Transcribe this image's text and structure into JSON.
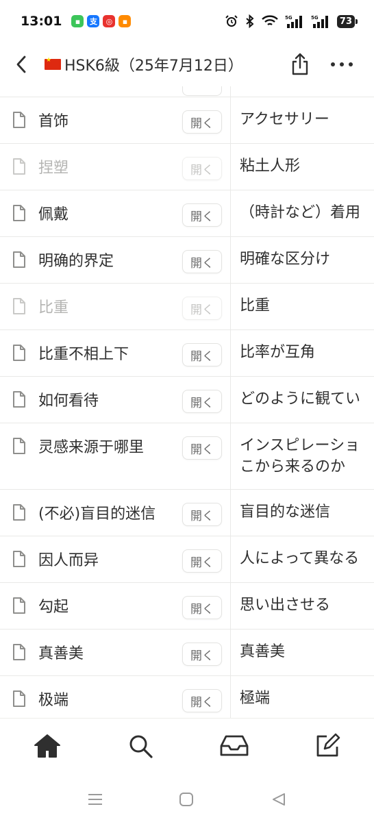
{
  "status_bar": {
    "time": "13:01",
    "battery": "73",
    "network_1": "5G",
    "network_2": "5G",
    "app_icons": [
      "messages-app-icon",
      "alipay-app-icon",
      "netease-app-icon",
      "orange-app-icon"
    ]
  },
  "header": {
    "title": "HSK6級（25年7月12日）",
    "flag": "china-flag-icon"
  },
  "rows": [
    {
      "term": "首饰",
      "open_label": "開く",
      "meaning": "アクセサリー",
      "dim": false
    },
    {
      "term": "捏塑",
      "open_label": "開く",
      "meaning": "粘土人形",
      "dim": true
    },
    {
      "term": "佩戴",
      "open_label": "開く",
      "meaning": "（時計など）着用",
      "dim": false
    },
    {
      "term": "明确的界定",
      "open_label": "開く",
      "meaning": "明確な区分け",
      "dim": false
    },
    {
      "term": "比重",
      "open_label": "開く",
      "meaning": "比重",
      "dim": true
    },
    {
      "term": "比重不相上下",
      "open_label": "開く",
      "meaning": "比率が互角",
      "dim": false
    },
    {
      "term": "如何看待",
      "open_label": "開く",
      "meaning": "どのように観てい",
      "dim": false
    },
    {
      "term": "灵感来源于哪里",
      "open_label": "開く",
      "meaning": "インスピレーショ\nこから来るのか",
      "dim": false
    },
    {
      "term": "(不必)盲目的迷信",
      "open_label": "開く",
      "meaning": "盲目的な迷信",
      "dim": false
    },
    {
      "term": "因人而异",
      "open_label": "開く",
      "meaning": "人によって異なる",
      "dim": false
    },
    {
      "term": "勾起",
      "open_label": "開く",
      "meaning": "思い出させる",
      "dim": false
    },
    {
      "term": "真善美",
      "open_label": "開く",
      "meaning": "真善美",
      "dim": false
    },
    {
      "term": "极端",
      "open_label": "開く",
      "meaning": "極端",
      "dim": false
    }
  ],
  "bottom_nav": [
    "home-icon",
    "search-icon",
    "inbox-icon",
    "compose-icon"
  ],
  "system_nav": [
    "recent-apps-icon",
    "home-square-icon",
    "back-triangle-icon"
  ]
}
